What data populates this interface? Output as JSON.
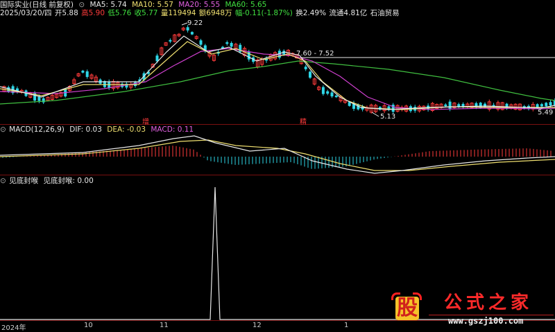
{
  "colors": {
    "up": "#ff3b3b",
    "down": "#2ed6e6",
    "ma5": "#e8e8e8",
    "ma10": "#f0e070",
    "ma20": "#d040d0",
    "ma60": "#40c040",
    "panel_sep": "#7a1010",
    "text_red": "#ff3b3b",
    "text_green": "#40e040",
    "text_yellow": "#f0e070",
    "text_magenta": "#e060e0",
    "text_white": "#e8e8e8"
  },
  "header": {
    "title": "国际实业(日线 前复权)",
    "ma5": "MA5: 5.74",
    "ma10": "MA10: 5.57",
    "ma20": "MA20: 5.55",
    "ma60": "MA60: 5.65"
  },
  "quote": {
    "date": "2025/03/20/四",
    "open": "开5.88",
    "high": "高5.90",
    "low": "低5.76",
    "close": "收5.77",
    "volume": "量119494",
    "amount": "额6948万",
    "change": "幅-0.11(-1.87%)",
    "turnover": "换2.49%",
    "float_cap": "流通4.81亿",
    "industry": "石油贸易"
  },
  "price_labels": {
    "high_mark": "9.22",
    "mid_mark": "7.60 - 7.52",
    "low_mark": "5.13",
    "last_mark": "5.49"
  },
  "markers": {
    "zeng": "增",
    "jian": "精"
  },
  "macd": {
    "name": "MACD(12,26,9)",
    "dif": "DIF: 0.03",
    "dea": "DEA: -0.03",
    "macd": "MACD: 0.11"
  },
  "indicator": {
    "name": "见底封喉",
    "label": "见底封喉: 0.00"
  },
  "xaxis": [
    "2024年",
    "10",
    "11",
    "12",
    "1"
  ],
  "watermark": {
    "logo_char": "股",
    "site_name": "公式之家",
    "url": "www.gszj100.com"
  },
  "chart_data": {
    "type": "candlestick",
    "panels": [
      "price",
      "macd",
      "indicator"
    ],
    "indicator_values": {
      "baseline": 0,
      "spike": 1
    }
  }
}
